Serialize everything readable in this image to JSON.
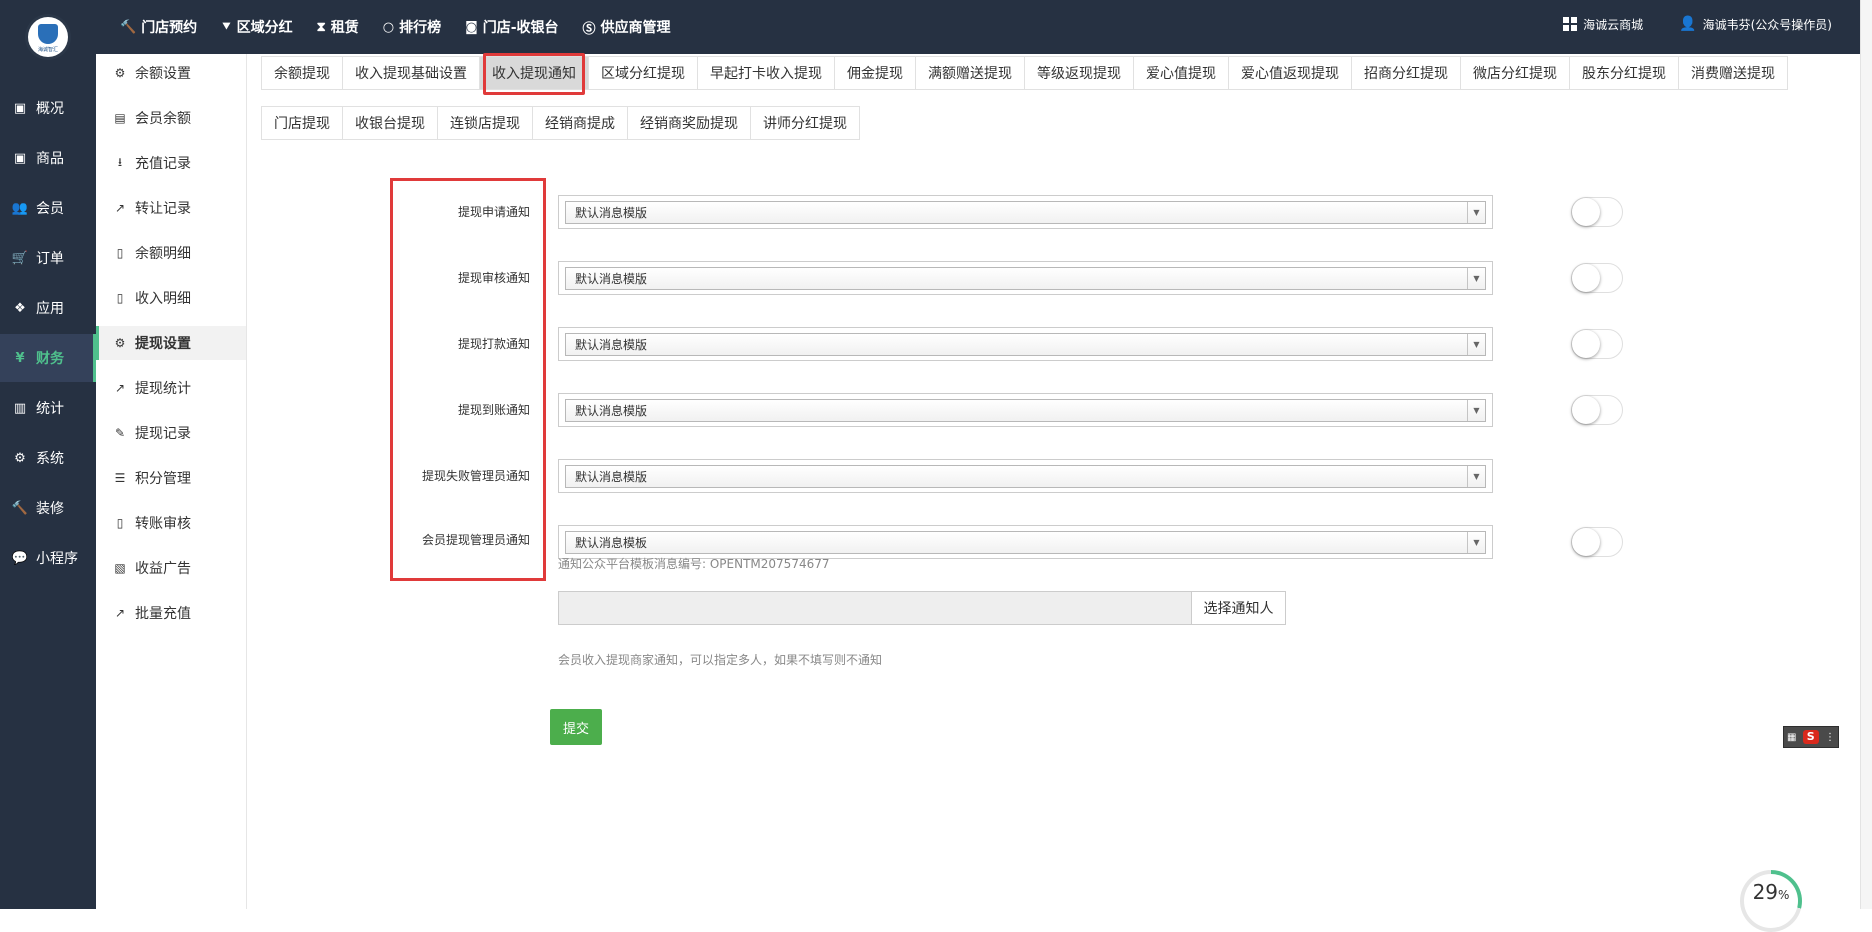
{
  "logo": {
    "text": "海诚智汇"
  },
  "top_nav": [
    {
      "icon": "gavel-icon",
      "glyph": "🔨",
      "label": "门店预约"
    },
    {
      "icon": "torch-icon",
      "glyph": "⯆",
      "label": "区域分红"
    },
    {
      "icon": "hourglass-icon",
      "glyph": "⧗",
      "label": "租赁"
    },
    {
      "icon": "circle-icon",
      "glyph": "○",
      "label": "排行榜"
    },
    {
      "icon": "camera-icon",
      "glyph": "◙",
      "label": "门店-收银台"
    },
    {
      "icon": "skype-icon",
      "glyph": "Ⓢ",
      "label": "供应商管理"
    }
  ],
  "top_right": {
    "shop_label": "海诚云商城",
    "user_label": "海诚韦芬(公众号操作员)"
  },
  "main_nav": [
    {
      "icon": "box-icon",
      "glyph": "▣",
      "label": "概况"
    },
    {
      "icon": "archive-icon",
      "glyph": "▣",
      "label": "商品"
    },
    {
      "icon": "users-icon",
      "glyph": "👥",
      "label": "会员"
    },
    {
      "icon": "cart-icon",
      "glyph": "🛒",
      "label": "订单"
    },
    {
      "icon": "cubes-icon",
      "glyph": "❖",
      "label": "应用"
    },
    {
      "icon": "yen-icon",
      "glyph": "¥",
      "label": "财务",
      "active": true
    },
    {
      "icon": "bar-chart-icon",
      "glyph": "▥",
      "label": "统计"
    },
    {
      "icon": "gears-icon",
      "glyph": "⚙",
      "label": "系统"
    },
    {
      "icon": "hammer-icon",
      "glyph": "🔨",
      "label": "装修"
    },
    {
      "icon": "wechat-icon",
      "glyph": "💬",
      "label": "小程序"
    }
  ],
  "sub_nav": [
    {
      "icon": "gear-icon",
      "glyph": "⚙",
      "label": "余额设置"
    },
    {
      "icon": "book-icon",
      "glyph": "▤",
      "label": "会员余额"
    },
    {
      "icon": "download-icon",
      "glyph": "⭳",
      "label": "充值记录"
    },
    {
      "icon": "external-link-icon",
      "glyph": "↗",
      "label": "转让记录"
    },
    {
      "icon": "file-icon",
      "glyph": "▯",
      "label": "余额明细"
    },
    {
      "icon": "file-icon",
      "glyph": "▯",
      "label": "收入明细"
    },
    {
      "icon": "gear-icon",
      "glyph": "⚙",
      "label": "提现设置",
      "active": true
    },
    {
      "icon": "line-chart-icon",
      "glyph": "↗",
      "label": "提现统计"
    },
    {
      "icon": "pencil-icon",
      "glyph": "✎",
      "label": "提现记录"
    },
    {
      "icon": "database-icon",
      "glyph": "☰",
      "label": "积分管理"
    },
    {
      "icon": "file-icon",
      "glyph": "▯",
      "label": "转账审核"
    },
    {
      "icon": "image-icon",
      "glyph": "▧",
      "label": "收益广告"
    },
    {
      "icon": "line-chart-icon",
      "glyph": "↗",
      "label": "批量充值"
    }
  ],
  "tabs_row1": [
    {
      "label": "余额提现"
    },
    {
      "label": "收入提现基础设置"
    },
    {
      "label": "收入提现通知",
      "active": true
    },
    {
      "label": "区域分红提现"
    },
    {
      "label": "早起打卡收入提现"
    },
    {
      "label": "佣金提现"
    },
    {
      "label": "满额赠送提现"
    },
    {
      "label": "等级返现提现"
    },
    {
      "label": "爱心值提现"
    },
    {
      "label": "爱心值返现提现"
    },
    {
      "label": "招商分红提现"
    },
    {
      "label": "微店分红提现"
    },
    {
      "label": "股东分红提现"
    },
    {
      "label": "消费赠送提现"
    }
  ],
  "tabs_row2": [
    {
      "label": "门店提现"
    },
    {
      "label": "收银台提现"
    },
    {
      "label": "连锁店提现"
    },
    {
      "label": "经销商提成"
    },
    {
      "label": "经销商奖励提现"
    },
    {
      "label": "讲师分红提现"
    }
  ],
  "form": {
    "rows": [
      {
        "label": "提现申请通知",
        "value": "默认消息模版",
        "has_toggle": true
      },
      {
        "label": "提现审核通知",
        "value": "默认消息模版",
        "has_toggle": true
      },
      {
        "label": "提现打款通知",
        "value": "默认消息模版",
        "has_toggle": true
      },
      {
        "label": "提现到账通知",
        "value": "默认消息模版",
        "has_toggle": true
      },
      {
        "label": "提现失败管理员通知",
        "value": "默认消息模版",
        "has_toggle": false
      },
      {
        "label": "会员提现管理员通知",
        "value": "默认消息模板",
        "has_toggle": true
      }
    ],
    "template_help": "通知公众平台模板消息编号: OPENTM207574677",
    "select_notifier_button": "选择通知人",
    "notifier_help": "会员收入提现商家通知，可以指定多人，如果不填写则不通知",
    "submit_label": "提交"
  },
  "ime_widget": {
    "label": "S"
  },
  "progress": {
    "value": "29",
    "unit": "%"
  },
  "colors": {
    "sidebar_bg": "#263142",
    "accent": "#4fc08d",
    "highlight_box": "#e03a3a",
    "submit": "#4cae4c"
  }
}
